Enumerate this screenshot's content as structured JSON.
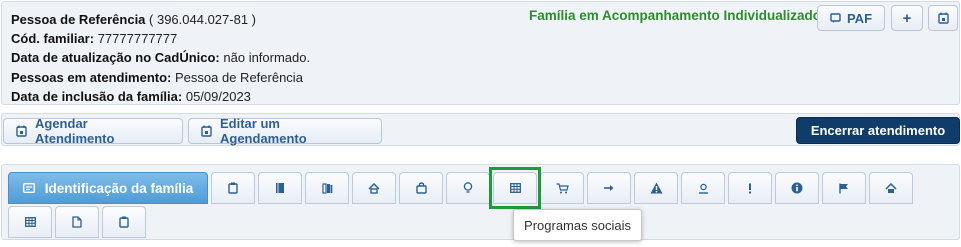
{
  "family_info": {
    "reference_label": "Pessoa de Referência",
    "reference_cpf": "( 396.044.027-81 )",
    "family_code_label": "Cód. familiar:",
    "family_code_value": "77777777777",
    "update_label": "Data de atualização no CadÚnico:",
    "update_value": "não informado.",
    "persons_label": "Pessoas em atendimento:",
    "persons_value": "Pessoa de Referência",
    "inclusion_label": "Data de inclusão da família:",
    "inclusion_value": "05/09/2023"
  },
  "status": {
    "text": "Família em Acompanhamento Individualizado",
    "color": "#2e8b2e"
  },
  "top_buttons": {
    "paf_label": "PAF",
    "add_label": "+"
  },
  "actions": {
    "schedule_label": "Agendar Atendimento",
    "edit_label": "Editar um Agendamento",
    "end_label": "Encerrar atendimento"
  },
  "tabs": {
    "active_label": "Identificação da família",
    "icons": [
      "clipboard-icon",
      "book-icon",
      "books-icon",
      "house-icon",
      "bag-icon",
      "bulb-icon",
      "table-icon",
      "cart-icon",
      "arrow-right-icon",
      "warning-icon",
      "user-circle-icon",
      "exclamation-icon",
      "info-icon",
      "flag-icon",
      "home-icon",
      "table-icon",
      "document-icon",
      "clipboard-icon"
    ]
  },
  "tooltip": {
    "text": "Programas sociais"
  },
  "colors": {
    "accent": "#2d5f93",
    "active_tab": "#4f9bd6",
    "end_button": "#0f3c68",
    "highlight": "#1f9a3a"
  }
}
